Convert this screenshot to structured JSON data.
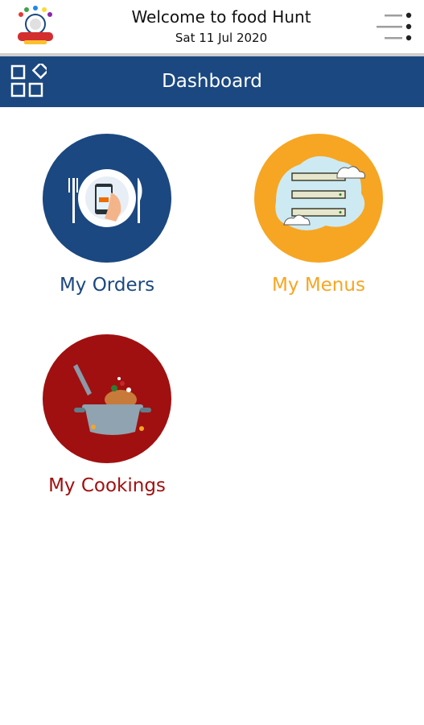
{
  "topbar": {
    "welcome_text": "Welcome to food Hunt",
    "date_text": "Sat 11 Jul 2020",
    "logo_icon": "food-hunt-logo",
    "menu_icon": "menu-icon"
  },
  "header": {
    "title": "Dashboard",
    "apps_icon": "apps-grid-icon",
    "background_color": "#1b4880"
  },
  "tiles": [
    {
      "label": "My Orders",
      "color": "#1b4880",
      "icon": "phone-plate-icon"
    },
    {
      "label": "My Menus",
      "color": "#f6a623",
      "icon": "menu-board-icon"
    },
    {
      "label": "My Cookings",
      "color": "#a01010",
      "icon": "cooking-pot-icon"
    }
  ]
}
